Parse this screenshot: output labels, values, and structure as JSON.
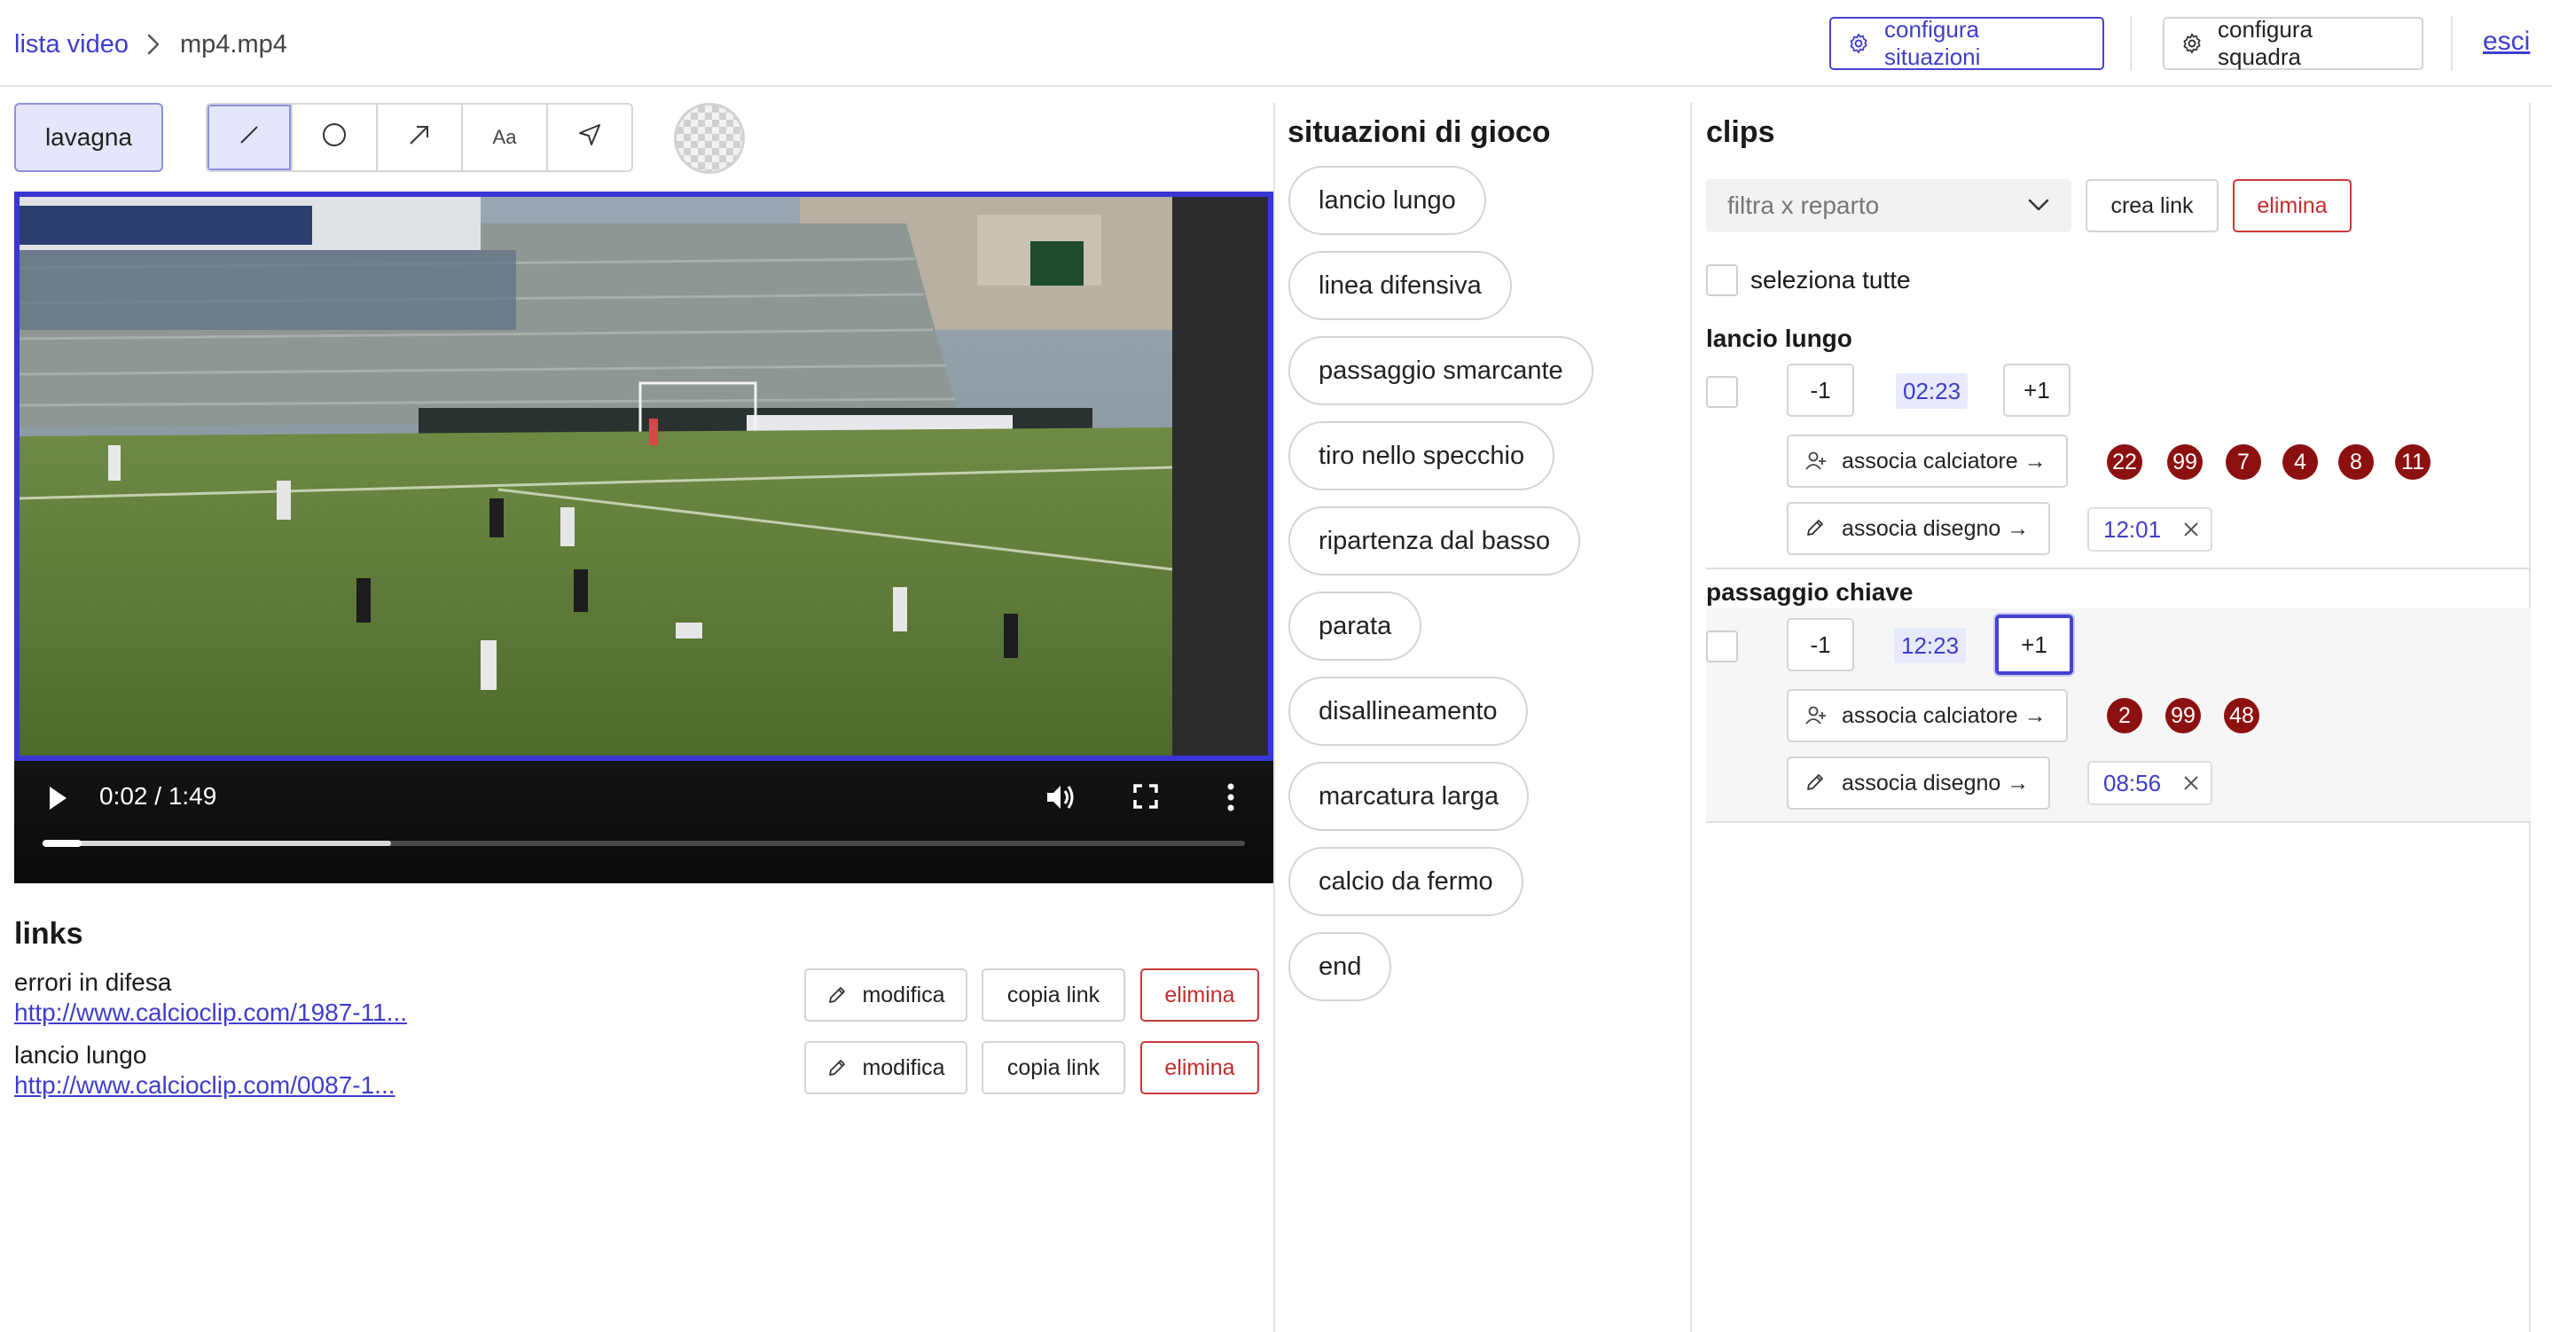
{
  "header": {
    "breadcrumb_root": "lista video",
    "breadcrumb_file": "mp4.mp4",
    "configure_situations": "configura situazioni",
    "configure_team": "configura squadra",
    "exit": "esci"
  },
  "toolbar": {
    "board_label": "lavagna",
    "tools": [
      {
        "name": "line",
        "icon": "line-icon",
        "active": true
      },
      {
        "name": "circle",
        "icon": "circle-icon",
        "active": false
      },
      {
        "name": "arrow",
        "icon": "arrow-icon",
        "active": false
      },
      {
        "name": "text",
        "icon": "text-icon",
        "label": "Aa",
        "active": false
      },
      {
        "name": "pointer",
        "icon": "send-icon",
        "active": false
      }
    ],
    "color_icon": "transparent-color-swatch"
  },
  "video": {
    "time": "0:02 / 1:49",
    "progress": 0.29,
    "accent": "#3b35d6"
  },
  "links": {
    "title": "links",
    "edit_label": "modifica",
    "copy_label": "copia link",
    "delete_label": "elimina",
    "items": [
      {
        "name": "errori in difesa",
        "url": "http://www.calcioclip.com/1987-11..."
      },
      {
        "name": "lancio lungo",
        "url": "http://www.calcioclip.com/0087-1..."
      }
    ]
  },
  "situations": {
    "title": "situazioni di gioco",
    "items": [
      "lancio lungo",
      "linea difensiva",
      "passaggio smarcante",
      "tiro nello specchio",
      "ripartenza dal basso",
      "parata",
      "disallineamento",
      "marcatura larga",
      "calcio da fermo",
      "end"
    ]
  },
  "clips": {
    "title": "clips",
    "filter_placeholder": "filtra x reparto",
    "create_link": "crea link",
    "delete": "elimina",
    "select_all": "seleziona tutte",
    "minus": "-1",
    "plus": "+1",
    "assoc_player": "associa calciatore →",
    "assoc_drawing": "associa disegno →",
    "groups": [
      {
        "title": "lancio lungo",
        "time": "02:23",
        "players": [
          "22",
          "99",
          "7",
          "4",
          "8",
          "11"
        ],
        "drawing": "12:01"
      },
      {
        "title": "passaggio chiave",
        "time": "12:23",
        "players": [
          "2",
          "99",
          "48"
        ],
        "drawing": "08:56"
      }
    ]
  },
  "colors": {
    "accent": "#4542d4",
    "danger": "#c32c2c",
    "badge": "#8c1010",
    "board_active": "#e4e6fb"
  }
}
